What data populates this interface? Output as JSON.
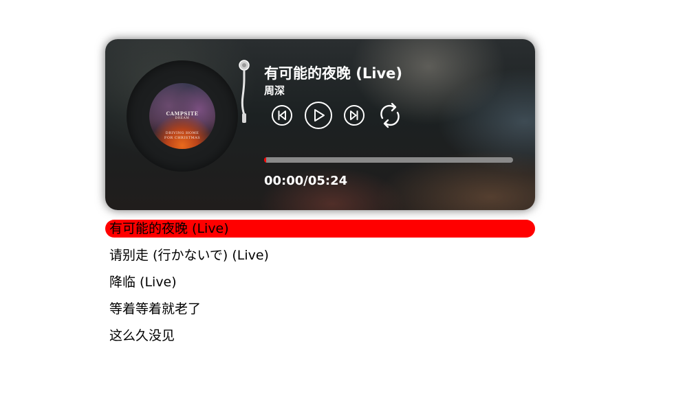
{
  "player": {
    "title": "有可能的夜晚 (Live)",
    "artist": "周深",
    "time": "00:00/05:24",
    "progress_fraction": 0.0,
    "colors": {
      "accent": "#ff0000",
      "progress_track": "#8a8a8a",
      "text": "#ffffff"
    },
    "cover": {
      "line1": "CAMPSITE",
      "line2": "DREAM",
      "line3": "DRIVING HOME",
      "line4": "FOR CHRISTMAS"
    },
    "controls": [
      {
        "name": "previous",
        "icon": "skip-previous-icon"
      },
      {
        "name": "play",
        "icon": "play-icon"
      },
      {
        "name": "next",
        "icon": "skip-next-icon"
      },
      {
        "name": "loop",
        "icon": "repeat-icon"
      }
    ]
  },
  "playlist": {
    "items": [
      {
        "label": "有可能的夜晚 (Live)",
        "active": true
      },
      {
        "label": "请别走 (行かないで) (Live)",
        "active": false
      },
      {
        "label": "降临 (Live)",
        "active": false
      },
      {
        "label": "等着等着就老了",
        "active": false
      },
      {
        "label": "这么久没见",
        "active": false
      }
    ]
  }
}
